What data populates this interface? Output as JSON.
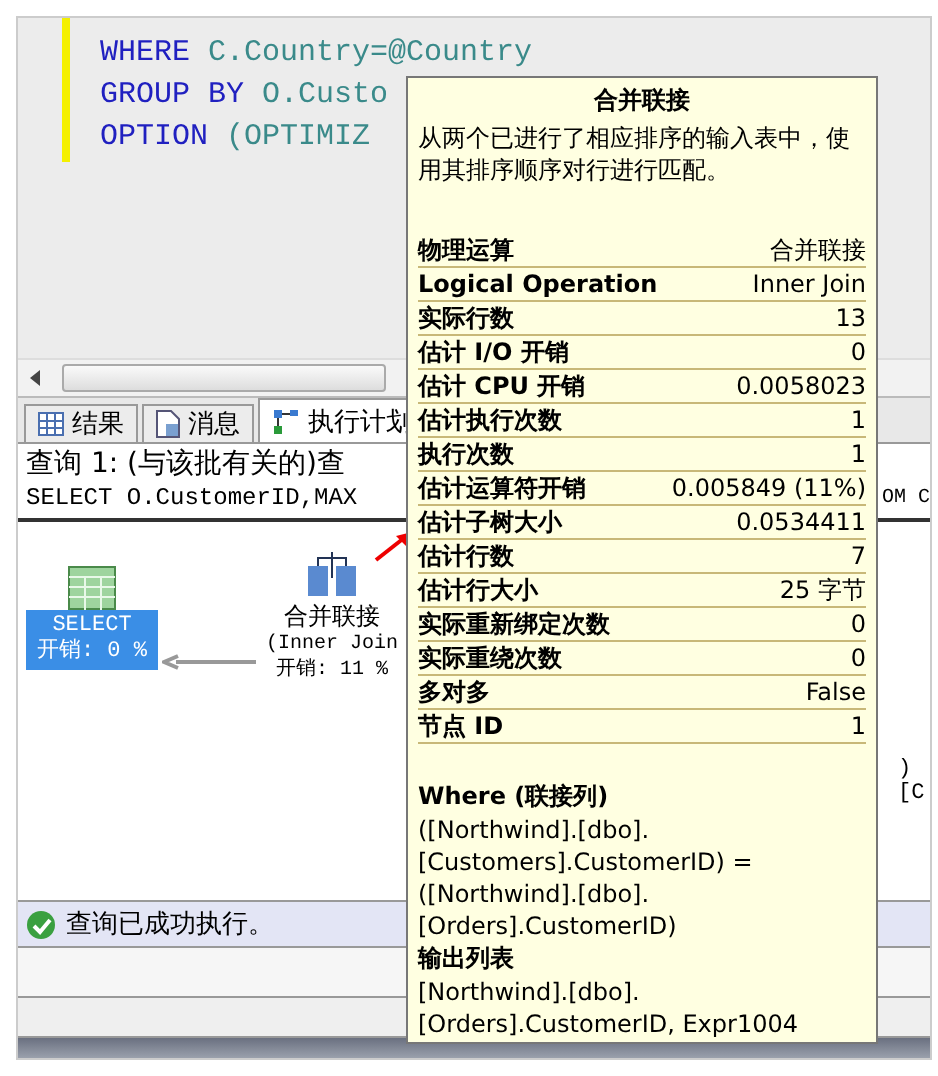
{
  "editor": {
    "lines": [
      {
        "keyword": "WHERE",
        "rest": "C.Country=@Country"
      },
      {
        "keyword": "GROUP BY",
        "rest": "O.Custo"
      },
      {
        "keyword": "OPTION",
        "rest": "(OPTIMIZ"
      }
    ]
  },
  "tabs": [
    {
      "label": "结果",
      "selected": false
    },
    {
      "label": "消息",
      "selected": false
    },
    {
      "label": "执行计划",
      "selected": true
    }
  ],
  "query": {
    "header": "查询 1: (与该批有关的)查",
    "sql": "SELECT O.CustomerID,MAX",
    "sql_tail": "OM C"
  },
  "plan": {
    "nodes": [
      {
        "kind": "select",
        "title": "SELECT",
        "cost": "开销: 0 %",
        "selected": true
      },
      {
        "kind": "join",
        "title": "合并联接",
        "subtitle": "(Inner Join",
        "cost": "开销: 11 %",
        "selected": false
      }
    ],
    "right_texts": [
      ")",
      "[C"
    ]
  },
  "tooltip": {
    "title": "合并联接",
    "description": "从两个已进行了相应排序的输入表中，使用其排序顺序对行进行匹配。",
    "properties": [
      {
        "label": "物理运算",
        "value": "合并联接"
      },
      {
        "label": "Logical Operation",
        "value": "Inner Join"
      },
      {
        "label": "实际行数",
        "value": "13"
      },
      {
        "label": "估计 I/O 开销",
        "value": "0"
      },
      {
        "label": "估计 CPU 开销",
        "value": "0.0058023"
      },
      {
        "label": "估计执行次数",
        "value": "1"
      },
      {
        "label": "执行次数",
        "value": "1"
      },
      {
        "label": "估计运算符开销",
        "value": "0.005849 (11%)"
      },
      {
        "label": "估计子树大小",
        "value": "0.0534411"
      },
      {
        "label": "估计行数",
        "value": "7"
      },
      {
        "label": "估计行大小",
        "value": "25 字节"
      },
      {
        "label": "实际重新绑定次数",
        "value": "0"
      },
      {
        "label": "实际重绕次数",
        "value": "0"
      },
      {
        "label": "多对多",
        "value": "False"
      },
      {
        "label": "节点 ID",
        "value": "1"
      }
    ],
    "sections": [
      {
        "heading": "Where (联接列)",
        "lines": [
          "([Northwind].[dbo].",
          "[Customers].CustomerID) =",
          "([Northwind].[dbo].",
          "[Orders].CustomerID)"
        ]
      },
      {
        "heading": "输出列表",
        "lines": [
          "[Northwind].[dbo].",
          "[Orders].CustomerID, Expr1004"
        ]
      }
    ]
  },
  "status_bar": {
    "message": "查询已成功执行。",
    "success": true
  }
}
